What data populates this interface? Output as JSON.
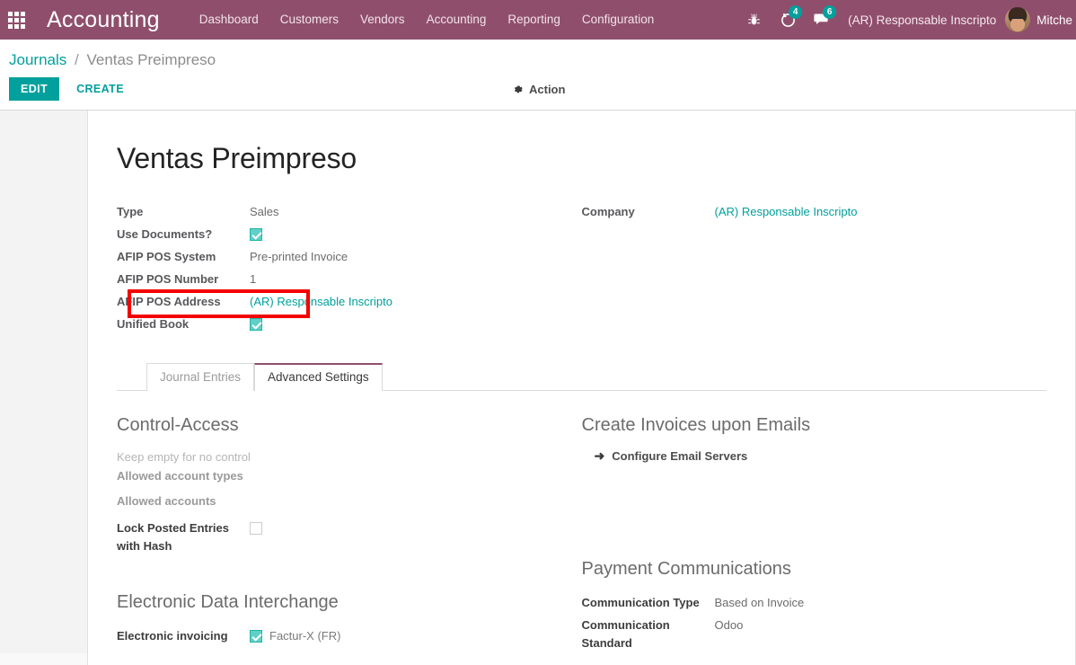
{
  "navbar": {
    "apps_icon": "apps-grid-icon",
    "brand": "Accounting",
    "menu": [
      {
        "label": "Dashboard"
      },
      {
        "label": "Customers"
      },
      {
        "label": "Vendors"
      },
      {
        "label": "Accounting"
      },
      {
        "label": "Reporting"
      },
      {
        "label": "Configuration"
      }
    ],
    "debug_icon": "bug-icon",
    "activities": {
      "icon": "clock-icon",
      "count": "4"
    },
    "messages": {
      "icon": "chat-icon",
      "count": "6"
    },
    "company": "(AR) Responsable Inscripto",
    "user_name": "Mitche",
    "avatar_icon": "user-avatar"
  },
  "control_panel": {
    "breadcrumb": {
      "parent": "Journals",
      "separator": "/",
      "current": "Ventas Preimpreso"
    },
    "edit_label": "EDIT",
    "create_label": "CREATE",
    "action_label": "Action",
    "action_icon": "gear-icon"
  },
  "record": {
    "title": "Ventas Preimpreso",
    "left_fields": [
      {
        "label": "Type",
        "value": "Sales",
        "kind": "text"
      },
      {
        "label": "Use Documents?",
        "value": "",
        "kind": "checkbox",
        "checked": true
      },
      {
        "label": "AFIP POS System",
        "value": "Pre-printed Invoice",
        "kind": "text"
      },
      {
        "label": "AFIP POS Number",
        "value": "1",
        "kind": "text"
      },
      {
        "label": "AFIP POS Address",
        "value": "(AR) Responsable Inscripto",
        "kind": "link"
      },
      {
        "label": "Unified Book",
        "value": "",
        "kind": "checkbox",
        "checked": true
      }
    ],
    "right_fields": [
      {
        "label": "Company",
        "value": "(AR) Responsable Inscripto",
        "kind": "link"
      }
    ]
  },
  "highlight": {
    "name": "use-documents-highlight",
    "color": "#f50000"
  },
  "tabs": [
    {
      "label": "Journal Entries",
      "active": false
    },
    {
      "label": "Advanced Settings",
      "active": true
    }
  ],
  "advanced_settings": {
    "control_access": {
      "title": "Control-Access",
      "hint": "Keep empty for no control",
      "allowed_account_types_label": "Allowed account types",
      "allowed_accounts_label": "Allowed accounts",
      "lock_label": "Lock Posted Entries with Hash",
      "lock_checked": false
    },
    "create_invoices": {
      "title": "Create Invoices upon Emails",
      "configure_link": "Configure Email Servers",
      "arrow_icon": "arrow-right-icon"
    },
    "edi": {
      "title": "Electronic Data Interchange",
      "invoicing_label": "Electronic invoicing",
      "format_label": "Factur-X (FR)",
      "format_checked": true
    },
    "payment_communications": {
      "title": "Payment Communications",
      "type_label": "Communication Type",
      "type_value": "Based on Invoice",
      "standard_label": "Communication Standard",
      "standard_value": "Odoo"
    }
  },
  "colors": {
    "brand_purple": "#8f4f6c",
    "accent_teal": "#00a09d",
    "checkbox_teal": "#62cfc5",
    "highlight_red": "#f50000"
  }
}
